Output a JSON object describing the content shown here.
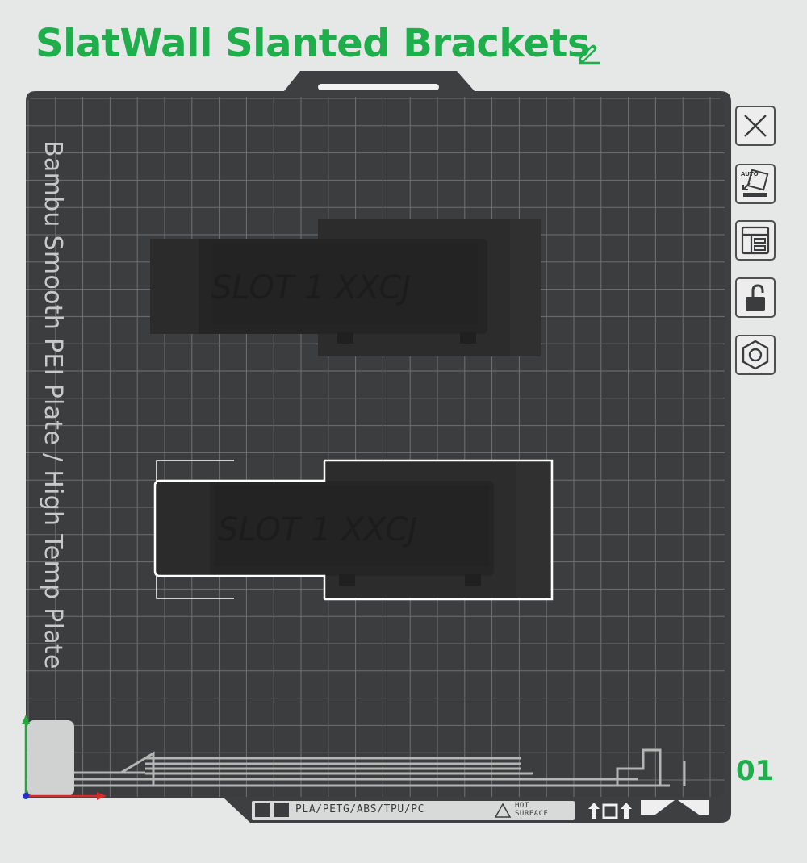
{
  "header": {
    "title": "SlatWall Slanted Brackets",
    "title_color": "#1fae4b"
  },
  "plate": {
    "name": "Bambu Smooth PEI Plate / High Temp Plate",
    "number": "01",
    "number_color": "#1fae4b",
    "bed_color": "#3b3d3e",
    "grid_color": "#6f7171",
    "material_text": "PLA/PETG/ABS/TPU/PC",
    "hot_surface_text": "HOT\nSURFACE"
  },
  "toolbar": {
    "items": [
      {
        "icon": "close-icon"
      },
      {
        "icon": "auto-orient-icon",
        "label": "AUTO"
      },
      {
        "icon": "arrange-icon"
      },
      {
        "icon": "unlock-icon"
      },
      {
        "icon": "hexagon-nut-icon"
      }
    ]
  },
  "objects": [
    {
      "name": "slanted-bracket-1",
      "embossed_text": "SLOT 1 XXCJ",
      "selected": false
    },
    {
      "name": "slanted-bracket-2",
      "embossed_text": "SLOT 1 XXCJ",
      "selected": true
    }
  ],
  "axes": {
    "x_color": "#d62b2b",
    "y_color": "#1faa3c",
    "z_color": "#2233cc"
  }
}
